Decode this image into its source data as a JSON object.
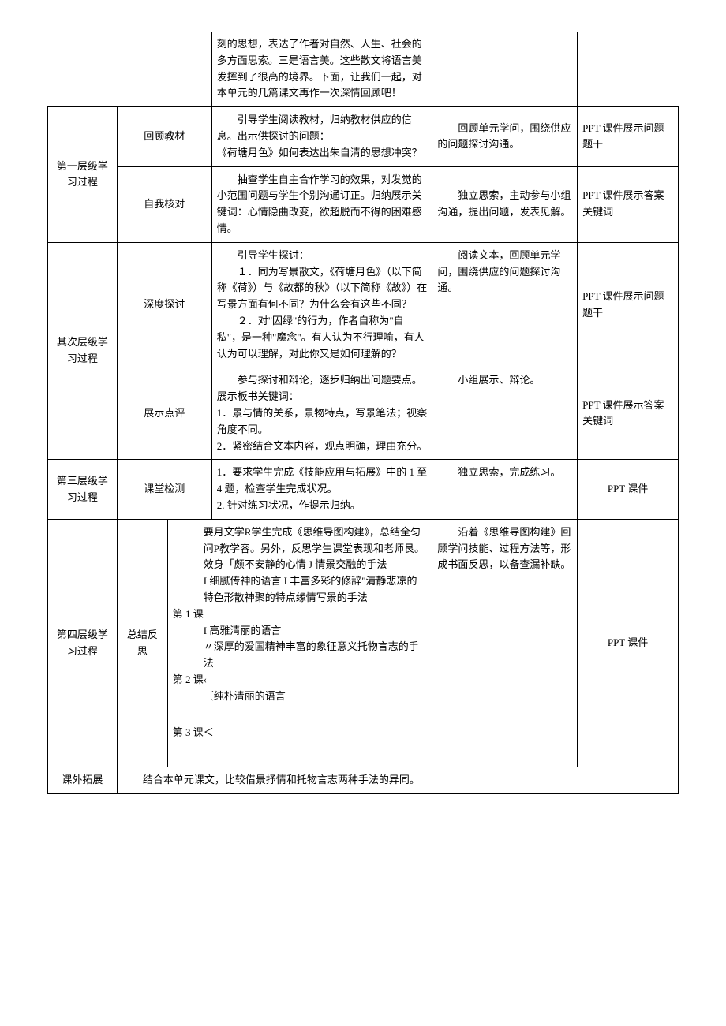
{
  "rows": [
    {
      "cells": [
        {
          "text": "刻的思想，表达了作者对自然、人生、社会的多方面思索。三是语言美。这些散文将语言美发挥到了很高的境界。下面，让我们一起，对本单元的几篇课文再作一次深情回顾吧！"
        }
      ]
    }
  ],
  "level1": {
    "title": "第一层级学习过程",
    "row1": {
      "sub": "回顾教材",
      "teacher": "引导学生阅读教材，归纳教材供应的信息。出示供探讨的问题：\n《荷塘月色》如何表达出朱自清的思想冲突？",
      "student": "回顾单元学问，围绕供应的问题探讨沟通。",
      "media": "PPT 课件展示问题题干"
    },
    "row2": {
      "sub": "自我核对",
      "teacher": "抽查学生自主合作学习的效果，对发觉的小范围问题与学生个别沟通订正。归纳展示关键词：心情隐曲改变，欲超脱而不得的困难感情。",
      "student": "独立思索，主动参与小组沟通，提出问题，发表见解。",
      "media": "PPT 课件展示答案关键词"
    }
  },
  "level2": {
    "title": "其次层级学习过程",
    "row1": {
      "sub": "深度探讨",
      "teacher_lead": "引导学生探讨：",
      "teacher_item1": "１．同为写景散文，《荷塘月色》（以下简称《荷》）与《故都的秋》（以下简称《故》）在写景方面有何不同？为什么会有这些不同？",
      "teacher_item2": "２．对\"囚绿\"的行为，作者自称为\"自私\"，是一种\"魔念\"。有人认为不行理喻，有人认为可以理解，对此你又是如何理解的？",
      "student": "阅读文本，回顾单元学问，围绕供应的问题探讨沟通。",
      "media": "PPT 课件展示问题题干"
    },
    "row2": {
      "sub": "展示点评",
      "teacher_lead": "参与探讨和辩论，逐步归纳出问题要点。",
      "teacher_line2": "展示板书关键词：",
      "teacher_item1": "1．景与情的关系，景物特点，写景笔法；视察角度不同。",
      "teacher_item2": "2．紧密结合文本内容，观点明确，理由充分。",
      "student": "小组展示、辩论。",
      "media": "PPT 课件展示答案关键词"
    }
  },
  "level3": {
    "title": "第三层级学习过程",
    "sub": "课堂检测",
    "teacher_item1": "1．要求学生完成《技能应用与拓展》中的 1 至 4 题，检查学生完成状况。",
    "teacher_item2": "2. 针对练习状况，作提示归纳。",
    "student": "独立思索，完成练习。",
    "media": "PPT 课件"
  },
  "level4": {
    "title": "第四层级学习过程",
    "sub": "总结反思",
    "teacher_p1": "要月文学R学生完成《思维导图构建》，总结全匀问P教学容。另外，反思学生课堂表现和老师艮。",
    "teacher_p2": "效身「颇不安静的心情 J 情景交融的手法",
    "teacher_p3": "I 细腻传神的语言 I 丰富多彩的修辞\"清静悲凉的特色形散神聚的特点缘情写景的手法",
    "lesson1": "第 1 课",
    "teacher_p4": "I 高雅清丽的语言",
    "teacher_p5": "〃深厚的爱国精神丰富的象征意义托物言志的手法",
    "lesson2": "第 2 课‹",
    "teacher_p6": "〔纯朴清丽的语言",
    "lesson3": "第 3 课＜",
    "student": "沿着《思维导图构建》回顾学问技能、过程方法等，形成书面反思，以备查漏补缺。",
    "media": "PPT 课件"
  },
  "extension": {
    "title": "课外拓展",
    "content": "结合本单元课文，比较借景抒情和托物言志两种手法的异同。"
  }
}
